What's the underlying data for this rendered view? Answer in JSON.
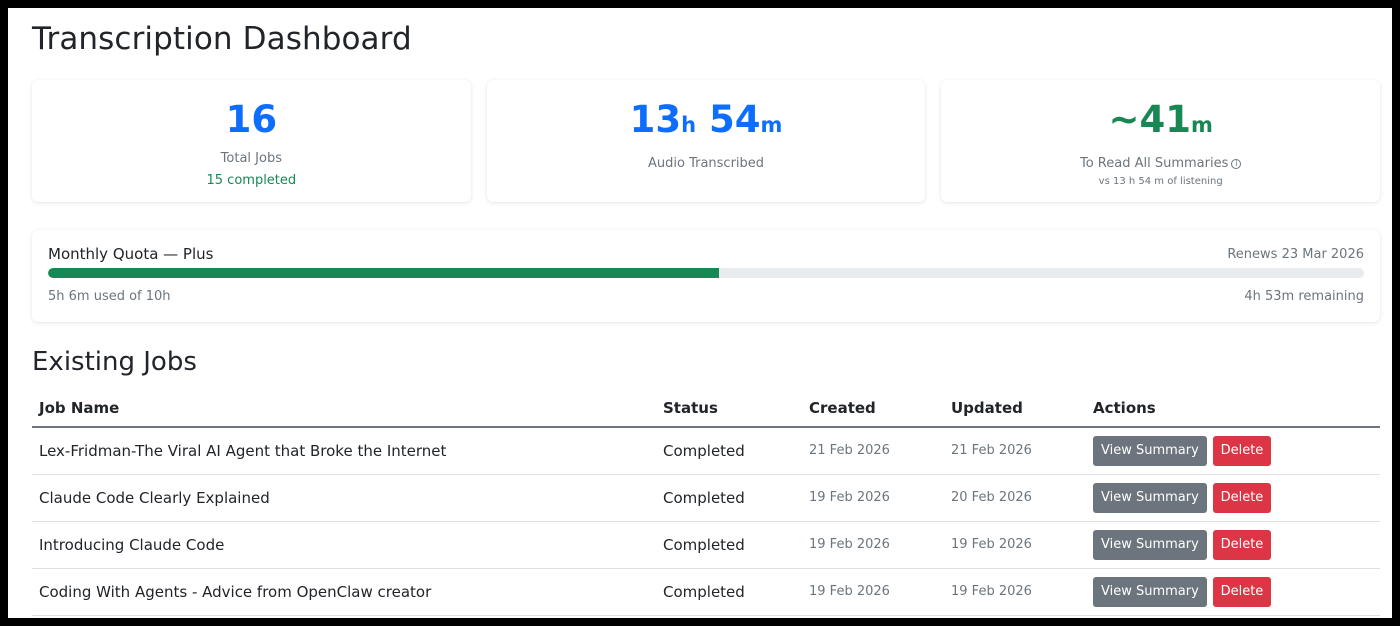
{
  "page": {
    "title": "Transcription Dashboard"
  },
  "stats": [
    {
      "value": "16",
      "unit": "",
      "label": "Total Jobs",
      "sub": "15 completed",
      "color": "#0d6efd"
    },
    {
      "value_a": "13",
      "unit_a": "h",
      "value_b": " 54",
      "unit_b": "m",
      "label": "Audio Transcribed",
      "color": "#0d6efd"
    },
    {
      "value": "~41",
      "unit": "m",
      "label": "To Read All Summaries",
      "info_icon": "info-circle-icon",
      "sub": "vs 13 h 54 m of listening",
      "color": "#198754"
    }
  ],
  "quota": {
    "title": "Monthly Quota — Plus",
    "renews": "Renews 23 Mar 2026",
    "used_text": "5h 6m used of 10h",
    "remaining_text": "4h 53m remaining",
    "progress_fraction": 0.51,
    "bar_color": "#198754"
  },
  "jobs_section": {
    "title": "Existing Jobs",
    "columns": [
      "Job Name",
      "Status",
      "Created",
      "Updated",
      "Actions"
    ],
    "rows": [
      {
        "name": "Lex-Fridman-The Viral AI Agent that Broke the Internet",
        "status": "Completed",
        "created": "21 Feb 2026",
        "updated": "21 Feb 2026"
      },
      {
        "name": "Claude Code Clearly Explained",
        "status": "Completed",
        "created": "19 Feb 2026",
        "updated": "20 Feb 2026"
      },
      {
        "name": "Introducing Claude Code",
        "status": "Completed",
        "created": "19 Feb 2026",
        "updated": "19 Feb 2026"
      },
      {
        "name": "Coding With Agents - Advice from OpenClaw creator",
        "status": "Completed",
        "created": "19 Feb 2026",
        "updated": "19 Feb 2026"
      }
    ],
    "view_label": "View Summary",
    "delete_label": "Delete"
  }
}
